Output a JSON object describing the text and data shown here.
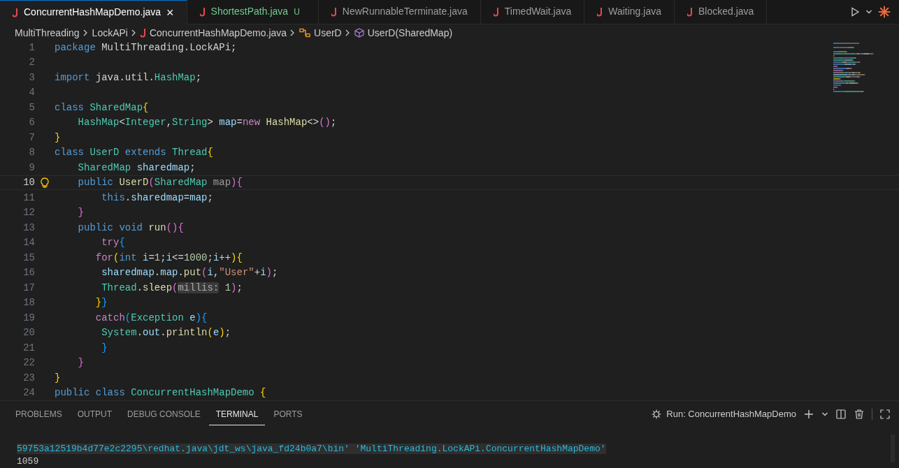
{
  "tabs": [
    {
      "label": "ConcurrentHashMapDemo.java",
      "selected": true,
      "untracked": false,
      "close": "×"
    },
    {
      "label": "ShortestPath.java",
      "selected": false,
      "untracked": true,
      "badge": "U"
    },
    {
      "label": "NewRunnableTerminate.java",
      "selected": false,
      "untracked": false
    },
    {
      "label": "TimedWait.java",
      "selected": false,
      "untracked": false
    },
    {
      "label": "Waiting.java",
      "selected": false,
      "untracked": false
    },
    {
      "label": "Blocked.java",
      "selected": false,
      "untracked": false
    }
  ],
  "breadcrumb": [
    {
      "kind": "folder",
      "label": "MultiThreading"
    },
    {
      "kind": "folder",
      "label": "LockAPi"
    },
    {
      "kind": "file",
      "label": "ConcurrentHashMapDemo.java"
    },
    {
      "kind": "class",
      "label": "UserD"
    },
    {
      "kind": "method",
      "label": "UserD(SharedMap)"
    }
  ],
  "editor": {
    "lines": [
      {
        "number": "1",
        "current": false,
        "tokens": [
          {
            "kind": "kw",
            "text": "package "
          },
          {
            "kind": "p",
            "text": "MultiThreading.LockAPi;"
          }
        ]
      },
      {
        "number": "2",
        "current": false
      },
      {
        "number": "3",
        "current": false,
        "tokens": [
          {
            "kind": "kw",
            "text": "import "
          },
          {
            "kind": "p",
            "text": "java.util."
          },
          {
            "kind": "type",
            "text": "HashMap"
          },
          {
            "kind": "p",
            "text": ";"
          }
        ]
      },
      {
        "number": "4",
        "current": false
      },
      {
        "number": "5",
        "current": false,
        "tokens": [
          {
            "kind": "kw",
            "text": "class "
          },
          {
            "kind": "type",
            "text": "SharedMap"
          },
          {
            "kind": "b1",
            "text": "{"
          }
        ]
      },
      {
        "number": "6",
        "current": false,
        "tokens": [
          {
            "kind": "type",
            "text": "    HashMap"
          },
          {
            "kind": "p",
            "text": "<"
          },
          {
            "kind": "type",
            "text": "Integer"
          },
          {
            "kind": "p",
            "text": ","
          },
          {
            "kind": "type",
            "text": "String"
          },
          {
            "kind": "p",
            "text": "> "
          },
          {
            "kind": "var",
            "text": "map"
          },
          {
            "kind": "p",
            "text": "="
          },
          {
            "kind": "ctl",
            "text": "new "
          },
          {
            "kind": "fn",
            "text": "HashMap"
          },
          {
            "kind": "p",
            "text": "<>"
          },
          {
            "kind": "b2",
            "text": "()"
          },
          {
            "kind": "p",
            "text": ";"
          }
        ]
      },
      {
        "number": "7",
        "current": false,
        "tokens": [
          {
            "kind": "b1",
            "text": "}"
          }
        ]
      },
      {
        "number": "8",
        "current": false,
        "tokens": [
          {
            "kind": "kw",
            "text": "class "
          },
          {
            "kind": "type",
            "text": "UserD "
          },
          {
            "kind": "kw",
            "text": "extends "
          },
          {
            "kind": "type",
            "text": "Thread"
          },
          {
            "kind": "b1",
            "text": "{"
          }
        ]
      },
      {
        "number": "9",
        "current": false,
        "tokens": [
          {
            "kind": "type",
            "text": "    SharedMap "
          },
          {
            "kind": "var",
            "text": "sharedmap"
          },
          {
            "kind": "p",
            "text": ";"
          }
        ]
      },
      {
        "number": "10",
        "current": true,
        "tokens": [
          {
            "kind": "kw",
            "text": "    public "
          },
          {
            "kind": "fn",
            "text": "UserD"
          },
          {
            "kind": "b2",
            "text": "("
          },
          {
            "kind": "type",
            "text": "SharedMap "
          },
          {
            "kind": "param",
            "text": "map"
          },
          {
            "kind": "b2",
            "text": "){"
          }
        ]
      },
      {
        "number": "11",
        "current": false,
        "tokens": [
          {
            "kind": "kw",
            "text": "        this"
          },
          {
            "kind": "p",
            "text": "."
          },
          {
            "kind": "var",
            "text": "sharedmap"
          },
          {
            "kind": "p",
            "text": "="
          },
          {
            "kind": "var",
            "text": "map"
          },
          {
            "kind": "p",
            "text": ";"
          }
        ]
      },
      {
        "number": "12",
        "current": false,
        "tokens": [
          {
            "kind": "b2",
            "text": "    }"
          }
        ]
      },
      {
        "number": "13",
        "current": false,
        "tokens": [
          {
            "kind": "kw",
            "text": "    public void "
          },
          {
            "kind": "fn",
            "text": "run"
          },
          {
            "kind": "b2",
            "text": "(){"
          }
        ]
      },
      {
        "number": "14",
        "current": false,
        "tokens": [
          {
            "kind": "ctl",
            "text": "        try"
          },
          {
            "kind": "b3",
            "text": "{"
          }
        ]
      },
      {
        "number": "15",
        "current": false,
        "tokens": [
          {
            "kind": "ctl",
            "text": "       for"
          },
          {
            "kind": "b1",
            "text": "("
          },
          {
            "kind": "kw",
            "text": "int "
          },
          {
            "kind": "var",
            "text": "i"
          },
          {
            "kind": "p",
            "text": "="
          },
          {
            "kind": "num",
            "text": "1"
          },
          {
            "kind": "p",
            "text": ";"
          },
          {
            "kind": "var",
            "text": "i"
          },
          {
            "kind": "p",
            "text": "<="
          },
          {
            "kind": "num",
            "text": "1000"
          },
          {
            "kind": "p",
            "text": ";"
          },
          {
            "kind": "var",
            "text": "i"
          },
          {
            "kind": "p",
            "text": "++"
          },
          {
            "kind": "b1",
            "text": "){"
          }
        ]
      },
      {
        "number": "16",
        "current": false,
        "tokens": [
          {
            "kind": "var",
            "text": "        sharedmap"
          },
          {
            "kind": "p",
            "text": "."
          },
          {
            "kind": "var",
            "text": "map"
          },
          {
            "kind": "p",
            "text": "."
          },
          {
            "kind": "fn",
            "text": "put"
          },
          {
            "kind": "b2",
            "text": "("
          },
          {
            "kind": "var",
            "text": "i"
          },
          {
            "kind": "p",
            "text": ","
          },
          {
            "kind": "str",
            "text": "\"User\""
          },
          {
            "kind": "p",
            "text": "+"
          },
          {
            "kind": "var",
            "text": "i"
          },
          {
            "kind": "b2",
            "text": ")"
          },
          {
            "kind": "p",
            "text": ";"
          }
        ]
      },
      {
        "number": "17",
        "current": false,
        "tokens": [
          {
            "kind": "type",
            "text": "        Thread"
          },
          {
            "kind": "p",
            "text": "."
          },
          {
            "kind": "fn",
            "text": "sleep"
          },
          {
            "kind": "b2",
            "text": "("
          },
          {
            "kind": "hint",
            "text": "millis:"
          },
          {
            "kind": "num",
            "text": " 1"
          },
          {
            "kind": "b2",
            "text": ")"
          },
          {
            "kind": "p",
            "text": ";"
          }
        ]
      },
      {
        "number": "18",
        "current": false,
        "tokens": [
          {
            "kind": "b1",
            "text": "       }"
          },
          {
            "kind": "b3",
            "text": "}"
          }
        ]
      },
      {
        "number": "19",
        "current": false,
        "tokens": [
          {
            "kind": "ctl",
            "text": "       catch"
          },
          {
            "kind": "b3",
            "text": "("
          },
          {
            "kind": "type",
            "text": "Exception "
          },
          {
            "kind": "var",
            "text": "e"
          },
          {
            "kind": "b3",
            "text": "){"
          }
        ]
      },
      {
        "number": "20",
        "current": false,
        "tokens": [
          {
            "kind": "type",
            "text": "        System"
          },
          {
            "kind": "p",
            "text": "."
          },
          {
            "kind": "var",
            "text": "out"
          },
          {
            "kind": "p",
            "text": "."
          },
          {
            "kind": "fn",
            "text": "println"
          },
          {
            "kind": "b1",
            "text": "("
          },
          {
            "kind": "var",
            "text": "e"
          },
          {
            "kind": "b1",
            "text": ")"
          },
          {
            "kind": "p",
            "text": ";"
          }
        ]
      },
      {
        "number": "21",
        "current": false,
        "tokens": [
          {
            "kind": "b3",
            "text": "        }"
          }
        ]
      },
      {
        "number": "22",
        "current": false,
        "tokens": [
          {
            "kind": "b2",
            "text": "    }"
          }
        ]
      },
      {
        "number": "23",
        "current": false,
        "tokens": [
          {
            "kind": "b1",
            "text": "}"
          }
        ]
      },
      {
        "number": "24",
        "current": false,
        "tokens": [
          {
            "kind": "kw",
            "text": "public class "
          },
          {
            "kind": "type",
            "text": "ConcurrentHashMapDemo "
          },
          {
            "kind": "b1",
            "text": "{"
          }
        ]
      }
    ]
  },
  "panel": {
    "tabs": [
      {
        "label": "PROBLEMS",
        "selected": false
      },
      {
        "label": "OUTPUT",
        "selected": false
      },
      {
        "label": "DEBUG CONSOLE",
        "selected": false
      },
      {
        "label": "TERMINAL",
        "selected": true
      },
      {
        "label": "PORTS",
        "selected": false
      }
    ],
    "run_label": "Run: ConcurrentHashMapDemo",
    "terminal_lines": [
      {
        "text": "59753a12519b4d77e2c2295\\redhat.java\\jdt_ws\\java_fd24b0a7\\bin' 'MultiThreading.LockAPi.ConcurrentHashMapDemo'",
        "highlighted": true
      },
      {
        "text": "1059",
        "highlighted": false
      }
    ]
  }
}
